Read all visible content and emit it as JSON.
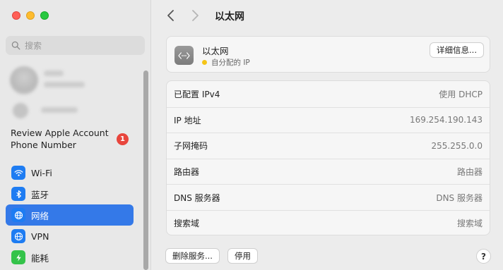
{
  "sidebar": {
    "search_placeholder": "搜索",
    "review": {
      "line1": "Review Apple Account",
      "line2": "Phone Number",
      "badge": "1"
    },
    "items": [
      {
        "label": "Wi-Fi",
        "icon": "wifi-icon",
        "active": false
      },
      {
        "label": "蓝牙",
        "icon": "bluetooth-icon",
        "active": false
      },
      {
        "label": "网络",
        "icon": "network-globe-icon",
        "active": true
      },
      {
        "label": "VPN",
        "icon": "vpn-globe-icon",
        "active": false
      },
      {
        "label": "能耗",
        "icon": "battery-bolt-icon",
        "active": false
      }
    ]
  },
  "header": {
    "title": "以太网"
  },
  "connection": {
    "name": "以太网",
    "status": "自分配的 IP",
    "status_color": "#f5c518",
    "details_button": "详细信息..."
  },
  "rows": [
    {
      "key": "已配置 IPv4",
      "value": "使用 DHCP"
    },
    {
      "key": "IP 地址",
      "value": "169.254.190.143"
    },
    {
      "key": "子网掩码",
      "value": "255.255.0.0"
    },
    {
      "key": "路由器",
      "value": "路由器"
    },
    {
      "key": "DNS 服务器",
      "value": "DNS 服务器"
    },
    {
      "key": "搜索域",
      "value": "搜索域"
    }
  ],
  "footer": {
    "delete_service": "删除服务...",
    "disable": "停用",
    "help": "?"
  },
  "colors": {
    "accent": "#3479e8",
    "badge": "#e8453c"
  }
}
